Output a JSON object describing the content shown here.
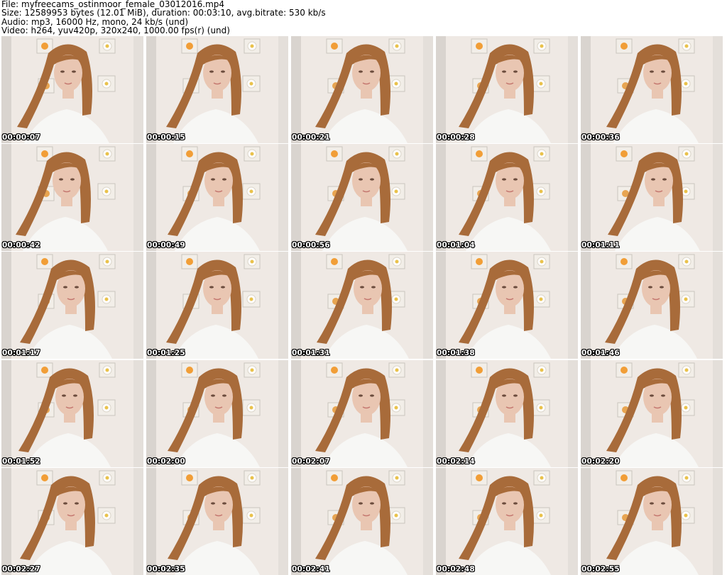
{
  "header": {
    "file": "File: myfreecams_ostinmoor_female_03012016.mp4",
    "size": "Size: 12589953 bytes (12.01 MiB), duration: 00:03:10, avg.bitrate: 530 kb/s",
    "audio": "Audio: mp3, 16000 Hz, mono, 24 kb/s (und)",
    "video": "Video: h264, yuv420p, 320x240, 1000.00 fps(r) (und)"
  },
  "colors": {
    "wall": "#efe9e4",
    "hair": "#a86b3a",
    "skin": "#e9c6b2",
    "sweater": "#f7f7f5"
  },
  "thumbnails": [
    {
      "time": "00:00:07"
    },
    {
      "time": "00:00:15"
    },
    {
      "time": "00:00:21"
    },
    {
      "time": "00:00:28"
    },
    {
      "time": "00:00:36"
    },
    {
      "time": "00:00:42"
    },
    {
      "time": "00:00:49"
    },
    {
      "time": "00:00:56"
    },
    {
      "time": "00:01:04"
    },
    {
      "time": "00:01:11"
    },
    {
      "time": "00:01:17"
    },
    {
      "time": "00:01:25"
    },
    {
      "time": "00:01:31"
    },
    {
      "time": "00:01:38"
    },
    {
      "time": "00:01:46"
    },
    {
      "time": "00:01:52"
    },
    {
      "time": "00:02:00"
    },
    {
      "time": "00:02:07"
    },
    {
      "time": "00:02:14"
    },
    {
      "time": "00:02:20"
    },
    {
      "time": "00:02:27"
    },
    {
      "time": "00:02:35"
    },
    {
      "time": "00:02:41"
    },
    {
      "time": "00:02:48"
    },
    {
      "time": "00:02:55"
    }
  ]
}
